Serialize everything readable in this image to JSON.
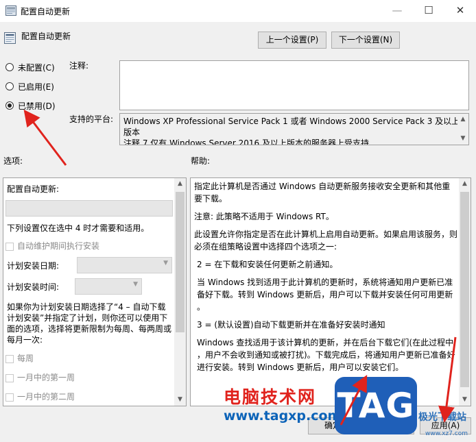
{
  "window": {
    "title": "配置自动更新",
    "minimize_glyph": "—",
    "maximize_glyph": "☐",
    "close_glyph": "✕"
  },
  "header": {
    "policy_title": "配置自动更新",
    "prev_button": "上一个设置(P)",
    "next_button": "下一个设置(N)"
  },
  "state": {
    "options": [
      {
        "label": "未配置(C)",
        "selected": false
      },
      {
        "label": "已启用(E)",
        "selected": false
      },
      {
        "label": "已禁用(D)",
        "selected": true
      }
    ]
  },
  "comment": {
    "label": "注释:",
    "value": ""
  },
  "platform": {
    "label": "支持的平台:",
    "line1": "Windows XP Professional Service Pack 1 或者 Windows 2000 Service Pack 3 及以上",
    "line2": "版本",
    "line3": "注释 7 仅有 Windows Server 2016 及以上版本的服务器上受支持"
  },
  "sections": {
    "options_label": "选项:",
    "help_label": "帮助:"
  },
  "options_panel": {
    "heading": "配置自动更新:",
    "note": "下列设置仅在选中 4 时才需要和适用。",
    "maint_checkbox": "自动维护期间执行安装",
    "schedule_day_label": "计划安装日期:",
    "schedule_time_label": "计划安装时间:",
    "para": "如果你为计划安装日期选择了“4 – 自动下载并计划安装”并指定了计划，则你还可以使用下面的选项，选择将更新限制为每周、每两周或每月一次:",
    "para_lines": [
      "如果你为计划安装日期选择了“4 – 自动下载",
      "计划安装”并指定了计划，则你还可以使用下",
      "面的选项，选择将更新限制为每周、每两周或",
      "每月一次:"
    ],
    "weekly": "每周",
    "first_week": "一月中的第一周",
    "second_week": "一月中的第二周"
  },
  "help_panel": {
    "p1_lines": [
      "指定此计算机是否通过 Windows 自动更新服务接收安全更新和其他重",
      "要下载。"
    ],
    "p2": "注意: 此策略不适用于 Windows RT。",
    "p3_lines": [
      "此设置允许你指定是否在此计算机上启用自动更新。如果启用该服务，则",
      "必须在组策略设置中选择四个选项之一:"
    ],
    "p4": "2 = 在下载和安装任何更新之前通知。",
    "p5_lines": [
      "当 Windows 找到适用于此计算机的更新时，系统将通知用户更新已准",
      "备好下载。转到 Windows 更新后，用户可以下载并安装任何可用更新",
      "。"
    ],
    "p6": "3 = (默认设置)自动下载更新并在准备好安装时通知",
    "p7_lines": [
      "Windows 查找适用于该计算机的更新，并在后台下载它们(在此过程中",
      "，用户不会收到通知或被打扰)。下载完成后，将通知用户更新已准备好",
      "进行安装。转到 Windows 更新后，用户可以安装它们。"
    ]
  },
  "footer": {
    "ok_button": "确定",
    "cancel_button": "取消",
    "apply_button": "应用(A)"
  },
  "watermark": {
    "site_name": "电脑技术网",
    "url": "www.tagxp.com",
    "tag": "TAG",
    "xz_text": "极光下载站",
    "xz_url": "www.xz7.com"
  },
  "colors": {
    "arrow": "#e0231d",
    "tag_blue": "#1f5fb8"
  }
}
